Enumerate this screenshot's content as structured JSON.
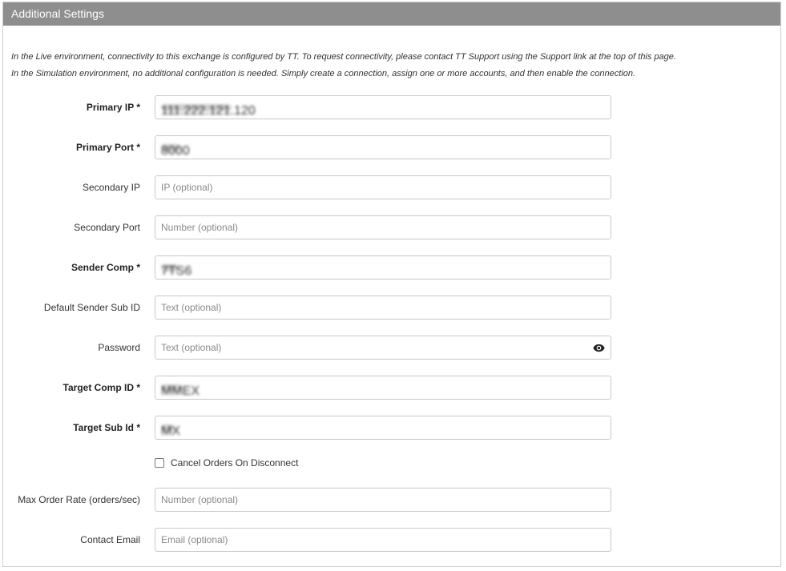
{
  "panel": {
    "title": "Additional Settings",
    "notes": [
      "In the Live environment, connectivity to this exchange is configured by TT. To request connectivity, please contact TT Support using the Support link at the top of this page.",
      "In the Simulation environment, no additional configuration is needed. Simply create a connection, assign one or more accounts, and then enable the connection."
    ]
  },
  "fields": {
    "primary_ip": {
      "label": "Primary IP *",
      "value": "111.222.121.120",
      "placeholder": ""
    },
    "primary_port": {
      "label": "Primary Port *",
      "value": "8000",
      "placeholder": ""
    },
    "secondary_ip": {
      "label": "Secondary IP",
      "value": "",
      "placeholder": "IP (optional)"
    },
    "secondary_port": {
      "label": "Secondary Port",
      "value": "",
      "placeholder": "Number (optional)"
    },
    "sender_comp": {
      "label": "Sender Comp *",
      "value": "7TS6",
      "placeholder": ""
    },
    "default_sender_sub_id": {
      "label": "Default Sender Sub ID",
      "value": "",
      "placeholder": "Text (optional)"
    },
    "password": {
      "label": "Password",
      "value": "",
      "placeholder": "Text (optional)",
      "toggle_icon": "eye-icon"
    },
    "target_comp_id": {
      "label": "Target Comp ID *",
      "value": "MMEX",
      "placeholder": ""
    },
    "target_sub_id": {
      "label": "Target Sub Id *",
      "value": "MX",
      "placeholder": ""
    },
    "cancel_orders_on_disconnect": {
      "label": "Cancel Orders On Disconnect",
      "checked": false
    },
    "max_order_rate": {
      "label": "Max Order Rate (orders/sec)",
      "value": "",
      "placeholder": "Number (optional)"
    },
    "contact_email": {
      "label": "Contact Email",
      "value": "",
      "placeholder": "Email (optional)"
    }
  },
  "colors": {
    "header_bg": "#8e8e8e",
    "header_text": "#ffffff",
    "border": "#c8c8c8"
  }
}
